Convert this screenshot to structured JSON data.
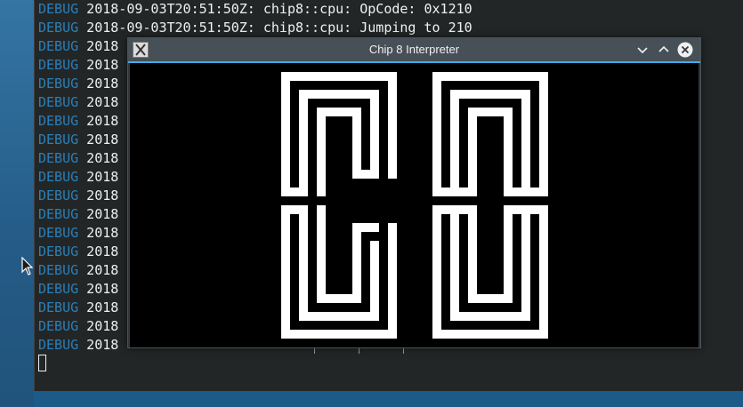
{
  "terminal": {
    "lines": [
      {
        "level": "DEBUG",
        "text": " 2018-09-03T20:51:50Z: chip8::cpu: OpCode: 0x1210"
      },
      {
        "level": "DEBUG",
        "text": " 2018-09-03T20:51:50Z: chip8::cpu: Jumping to 210"
      },
      {
        "level": "DEBUG",
        "text": " 2018"
      },
      {
        "level": "DEBUG",
        "text": " 2018"
      },
      {
        "level": "DEBUG",
        "text": " 2018"
      },
      {
        "level": "DEBUG",
        "text": " 2018"
      },
      {
        "level": "DEBUG",
        "text": " 2018"
      },
      {
        "level": "DEBUG",
        "text": " 2018"
      },
      {
        "level": "DEBUG",
        "text": " 2018"
      },
      {
        "level": "DEBUG",
        "text": " 2018"
      },
      {
        "level": "DEBUG",
        "text": " 2018"
      },
      {
        "level": "DEBUG",
        "text": " 2018"
      },
      {
        "level": "DEBUG",
        "text": " 2018"
      },
      {
        "level": "DEBUG",
        "text": " 2018"
      },
      {
        "level": "DEBUG",
        "text": " 2018"
      },
      {
        "level": "DEBUG",
        "text": " 2018"
      },
      {
        "level": "DEBUG",
        "text": " 2018"
      },
      {
        "level": "DEBUG",
        "text": " 2018"
      },
      {
        "level": "DEBUG",
        "text": " 2018"
      }
    ]
  },
  "emulator": {
    "title": "Chip 8 Interpreter",
    "app_icon": "x11-app-icon",
    "buttons": {
      "minimize": "chevron-down-icon",
      "maximize": "chevron-up-icon",
      "close": "close-icon"
    },
    "display_colors": {
      "on": "#ffffff",
      "off": "#000000"
    }
  },
  "colors": {
    "accent": "#3daee9",
    "debug_level": "#2980b9",
    "terminal_bg": "#232627"
  }
}
